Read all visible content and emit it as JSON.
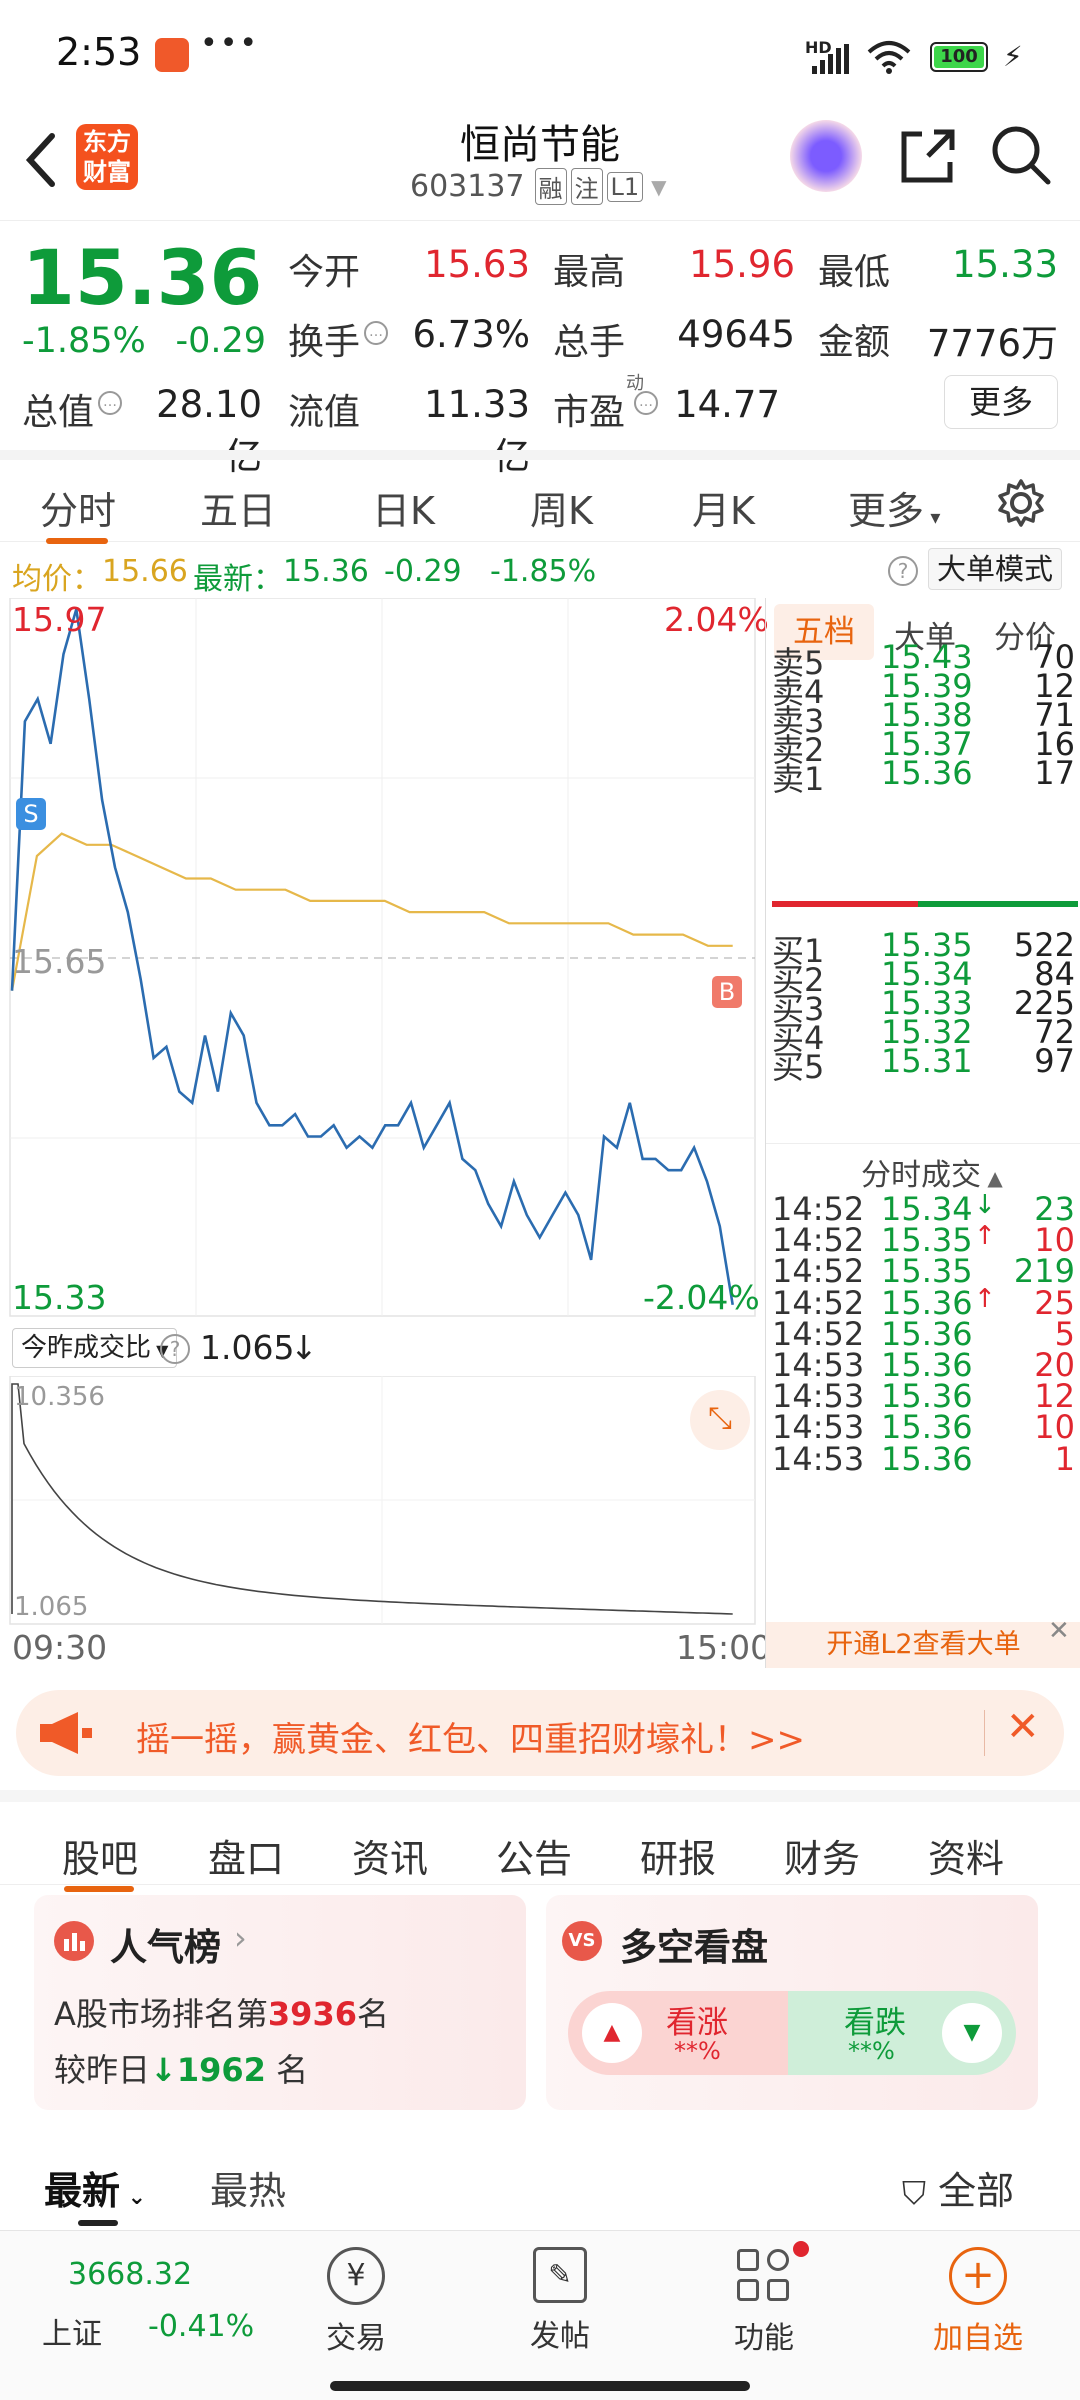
{
  "status_bar": {
    "time": "2:53",
    "more": "•••",
    "network": "HD",
    "battery": "100"
  },
  "header": {
    "brand_logo": "东方财富",
    "stock_name": "恒尚节能",
    "stock_code": "603137",
    "tags": [
      "融",
      "注",
      "L1"
    ]
  },
  "quote": {
    "price": "15.36",
    "change_pct": "-1.85%",
    "change_amt": "-0.29",
    "stats": {
      "open_label": "今开",
      "open": "15.63",
      "high_label": "最高",
      "high": "15.96",
      "low_label": "最低",
      "low": "15.33",
      "turnover_label": "换手",
      "turnover": "6.73%",
      "volume_label": "总手",
      "volume": "49645",
      "amount_label": "金额",
      "amount": "7776万",
      "mktcap_label": "总值",
      "mktcap": "28.10亿",
      "float_label": "流值",
      "float": "11.33亿",
      "pe_label": "市盈",
      "pe_sup": "动",
      "pe": "14.77",
      "more_button": "更多"
    }
  },
  "chart_tabs": [
    "分时",
    "五日",
    "日K",
    "周K",
    "月K",
    "更多"
  ],
  "info_line": {
    "avg_label": "均价：",
    "avg": "15.66",
    "latest_label": "最新：",
    "latest": "15.36",
    "change": "-0.29",
    "change_pct": "-1.85%",
    "mode_button": "大单模式"
  },
  "chart_labels": {
    "top_price": "15.97",
    "top_pct": "2.04%",
    "bottom_price": "15.33",
    "bottom_pct": "-2.04%",
    "mid_price": "15.65",
    "sell_marker": "S",
    "buy_marker": "B",
    "vol_selector": "今昨成交比",
    "vol_value": "1.065",
    "vol_arrow": "↓",
    "vol_top": "10.356",
    "vol_bottom": "1.065",
    "time_start": "09:30",
    "time_end": "15:00"
  },
  "chart_data": {
    "type": "line",
    "x_range": [
      "09:30",
      "15:00"
    ],
    "ylim": [
      15.33,
      15.97
    ],
    "series": [
      {
        "values": [
          15.62,
          15.86,
          15.88,
          15.84,
          15.92,
          15.96,
          15.88,
          15.79,
          15.73,
          15.69,
          15.63,
          15.56,
          15.57,
          15.53,
          15.52,
          15.58,
          15.53,
          15.6,
          15.58,
          15.52,
          15.5,
          15.5,
          15.51,
          15.49,
          15.49,
          15.5,
          15.48,
          15.49,
          15.48,
          15.5,
          15.5,
          15.52,
          15.48,
          15.5,
          15.52,
          15.47,
          15.46,
          15.43,
          15.41,
          15.45,
          15.42,
          15.4,
          15.42,
          15.44,
          15.42,
          15.38,
          15.49,
          15.48,
          15.52,
          15.47,
          15.47,
          15.46,
          15.46,
          15.48,
          15.45,
          15.41,
          15.34
        ]
      },
      {
        "values": [
          15.62,
          15.74,
          15.76,
          15.75,
          15.75,
          15.74,
          15.73,
          15.72,
          15.72,
          15.71,
          15.71,
          15.71,
          15.7,
          15.7,
          15.7,
          15.7,
          15.69,
          15.69,
          15.69,
          15.69,
          15.68,
          15.68,
          15.68,
          15.68,
          15.68,
          15.67,
          15.67,
          15.67,
          15.66,
          15.66
        ]
      }
    ]
  },
  "order_book": {
    "tabs": [
      "五档",
      "大单",
      "分价"
    ],
    "asks": [
      {
        "label": "卖5",
        "price": "15.43",
        "vol": "70"
      },
      {
        "label": "卖4",
        "price": "15.39",
        "vol": "12"
      },
      {
        "label": "卖3",
        "price": "15.38",
        "vol": "71"
      },
      {
        "label": "卖2",
        "price": "15.37",
        "vol": "16"
      },
      {
        "label": "卖1",
        "price": "15.36",
        "vol": "17"
      }
    ],
    "bids": [
      {
        "label": "买1",
        "price": "15.35",
        "vol": "522"
      },
      {
        "label": "买2",
        "price": "15.34",
        "vol": "84"
      },
      {
        "label": "买3",
        "price": "15.33",
        "vol": "225"
      },
      {
        "label": "买4",
        "price": "15.32",
        "vol": "72"
      },
      {
        "label": "买5",
        "price": "15.31",
        "vol": "97"
      }
    ],
    "trades_title": "分时成交",
    "trades": [
      {
        "time": "14:52",
        "price": "15.34",
        "arrow": "↓",
        "vol": "23",
        "dir": "down"
      },
      {
        "time": "14:52",
        "price": "15.35",
        "arrow": "↑",
        "vol": "10",
        "dir": "up"
      },
      {
        "time": "14:52",
        "price": "15.35",
        "arrow": "",
        "vol": "219",
        "dir": "down"
      },
      {
        "time": "14:52",
        "price": "15.36",
        "arrow": "↑",
        "vol": "25",
        "dir": "up"
      },
      {
        "time": "14:52",
        "price": "15.36",
        "arrow": "",
        "vol": "5",
        "dir": "up"
      },
      {
        "time": "14:53",
        "price": "15.36",
        "arrow": "",
        "vol": "20",
        "dir": "up"
      },
      {
        "time": "14:53",
        "price": "15.36",
        "arrow": "",
        "vol": "12",
        "dir": "up"
      },
      {
        "time": "14:53",
        "price": "15.36",
        "arrow": "",
        "vol": "10",
        "dir": "up"
      },
      {
        "time": "14:53",
        "price": "15.36",
        "arrow": "",
        "vol": "1",
        "dir": "up"
      }
    ],
    "l2_link": "开通L2查看大单"
  },
  "promo": {
    "text": "摇一摇，赢黄金、红包、四重招财壕礼！>>"
  },
  "section_tabs": [
    "股吧",
    "盘口",
    "资讯",
    "公告",
    "研报",
    "财务",
    "资料"
  ],
  "popularity": {
    "title": "人气榜",
    "rank_prefix": "A股市场排名第",
    "rank": "3936",
    "rank_suffix": "名",
    "change_prefix": "较昨日",
    "change_arrow": "↓",
    "change": "1962",
    "change_suffix": "名"
  },
  "sentiment": {
    "title": "多空看盘",
    "bull_label": "看涨",
    "bull_value": "**%",
    "bear_label": "看跌",
    "bear_value": "**%"
  },
  "feed": {
    "latest": "最新",
    "hot": "最热",
    "filter": "全部"
  },
  "bottom_nav": {
    "index_value": "3668.32",
    "index_name": "上证",
    "index_change": "-0.41%",
    "trade": "交易",
    "post": "发帖",
    "functions": "功能",
    "add_watch": "加自选"
  },
  "colors": {
    "up": "#e0262f",
    "down": "#0e9b3a",
    "accent": "#e8640f",
    "price_line": "#2b6cb0",
    "avg_line": "#e6b84a"
  }
}
